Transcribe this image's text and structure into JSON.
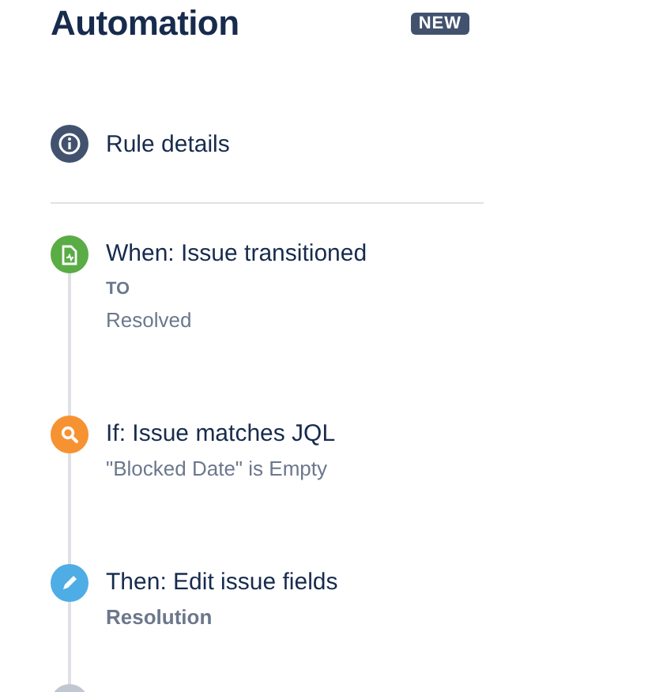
{
  "header": {
    "title": "Automation",
    "badge": "NEW"
  },
  "rule_details": {
    "label": "Rule details"
  },
  "steps": [
    {
      "kind": "trigger",
      "color": "#5aac44",
      "title": "When: Issue transitioned",
      "details": [
        {
          "kind": "label",
          "text": "TO"
        },
        {
          "kind": "value",
          "text": "Resolved"
        }
      ]
    },
    {
      "kind": "condition",
      "color": "#f79232",
      "title": "If: Issue matches JQL",
      "details": [
        {
          "kind": "value",
          "text": "\"Blocked Date\" is Empty"
        }
      ]
    },
    {
      "kind": "action",
      "color": "#4fade6",
      "title": "Then: Edit issue fields",
      "details": [
        {
          "kind": "emphasis",
          "text": "Resolution"
        }
      ]
    },
    {
      "kind": "next",
      "color": "#c1c7d0"
    }
  ]
}
